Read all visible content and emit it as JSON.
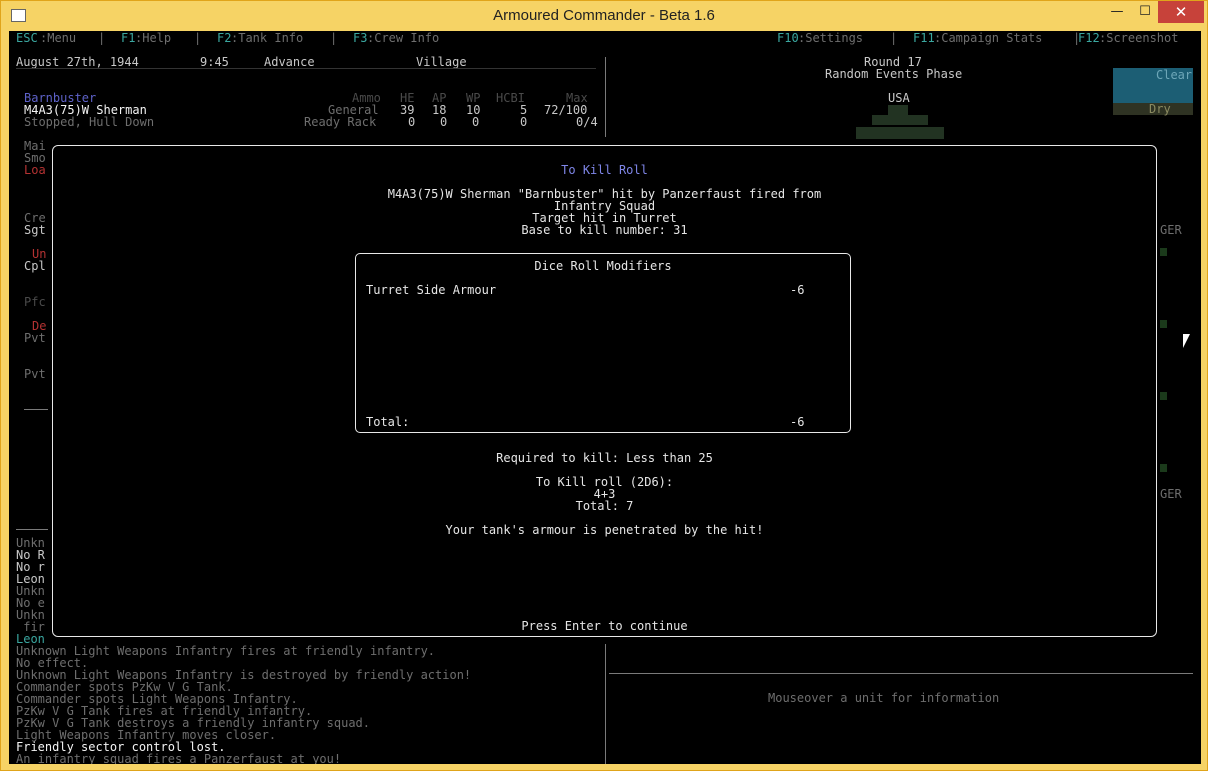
{
  "window": {
    "title": "Armoured Commander - Beta 1.6",
    "min_glyph": "—",
    "max_glyph": "☐",
    "close_glyph": "✕"
  },
  "menu": {
    "esc": {
      "key": "ESC",
      "label": ":Menu"
    },
    "f1": {
      "key": "F1",
      "label": ":Help"
    },
    "f2": {
      "key": "F2",
      "label": ":Tank Info"
    },
    "f3": {
      "key": "F3",
      "label": ":Crew Info"
    },
    "f10": {
      "key": "F10",
      "label": ":Settings"
    },
    "f11": {
      "key": "F11",
      "label": ":Campaign Stats"
    },
    "f12": {
      "key": "F12",
      "label": ":Screenshot"
    },
    "sep": "|"
  },
  "status": {
    "date": "August 27th, 1944",
    "time": "9:45",
    "mission": "Advance",
    "terrain": "Village"
  },
  "tank": {
    "name": "Barnbuster",
    "model": "M4A3(75)W Sherman",
    "state": "Stopped, Hull Down",
    "ammo_headers": [
      "Ammo",
      "HE",
      "AP",
      "WP",
      "HCBI",
      "Max"
    ],
    "ammo_rows": [
      {
        "label": "General",
        "he": "39",
        "ap": "18",
        "wp": "10",
        "hcbi": "5",
        "max": "72/100"
      },
      {
        "label": "Ready Rack",
        "he": "0",
        "ap": "0",
        "wp": "0",
        "hcbi": "0",
        "max": "0/4"
      }
    ]
  },
  "side_left": {
    "frag1": [
      "Mai",
      "Smo"
    ],
    "frag_red1": "Loa",
    "frag2": [
      "Cre",
      "Sgt"
    ],
    "frag_red2": "Un",
    "frag3": "Cpl",
    "frag4": "Pfc",
    "frag_red3": "De",
    "frag5": "Pvt",
    "frag6": "Pvt"
  },
  "round": {
    "label": "Round 17",
    "phase": "Random Events Phase"
  },
  "weather": {
    "sky": "Clear",
    "ground": "Dry"
  },
  "map": {
    "nation": "USA",
    "enemy_label_1": "GER",
    "enemy_label_2": "GER"
  },
  "dialog": {
    "title": "To Kill Roll",
    "line1": "M4A3(75)W Sherman \"Barnbuster\" hit by Panzerfaust fired from",
    "line2": "Infantry Squad",
    "line3": "Target hit in Turret",
    "line4": "Base to kill number: 31",
    "modifiers_title": "Dice Roll Modifiers",
    "modifiers": [
      {
        "label": "Turret Side Armour",
        "value": "-6"
      }
    ],
    "total_label": "Total:",
    "total_value": "-6",
    "required": "Required to kill: Less than 25",
    "roll_label": "To Kill roll (2D6):",
    "roll_dice": "4+3",
    "roll_total": "Total: 7",
    "result": "Your tank's armour is penetrated by the hit!",
    "continue": "Press Enter to continue"
  },
  "log_fragments": [
    "Unkn",
    "No R",
    "No r",
    "Leon",
    "Unkn",
    "No e",
    "Unkn",
    " fir"
  ],
  "log_teal": "Leon",
  "message_log": [
    "Unknown Light Weapons Infantry fires at friendly infantry.",
    "No effect.",
    "Unknown Light Weapons Infantry is destroyed by friendly action!",
    "Commander spots PzKw V G Tank.",
    "Commander spots Light Weapons Infantry.",
    "PzKw V G Tank fires at friendly infantry.",
    "PzKw V G Tank destroys a friendly infantry squad.",
    "Light Weapons Infantry moves closer.",
    "Friendly sector control lost.",
    "An infantry squad fires a Panzerfaust at you!"
  ],
  "info_panel": "Mouseover a unit for information",
  "colors": {
    "accent_teal": "#3aa7a0",
    "title_blue": "#7f86e8",
    "weather_blue": "#1c5e74",
    "window_frame": "#f6d365"
  }
}
